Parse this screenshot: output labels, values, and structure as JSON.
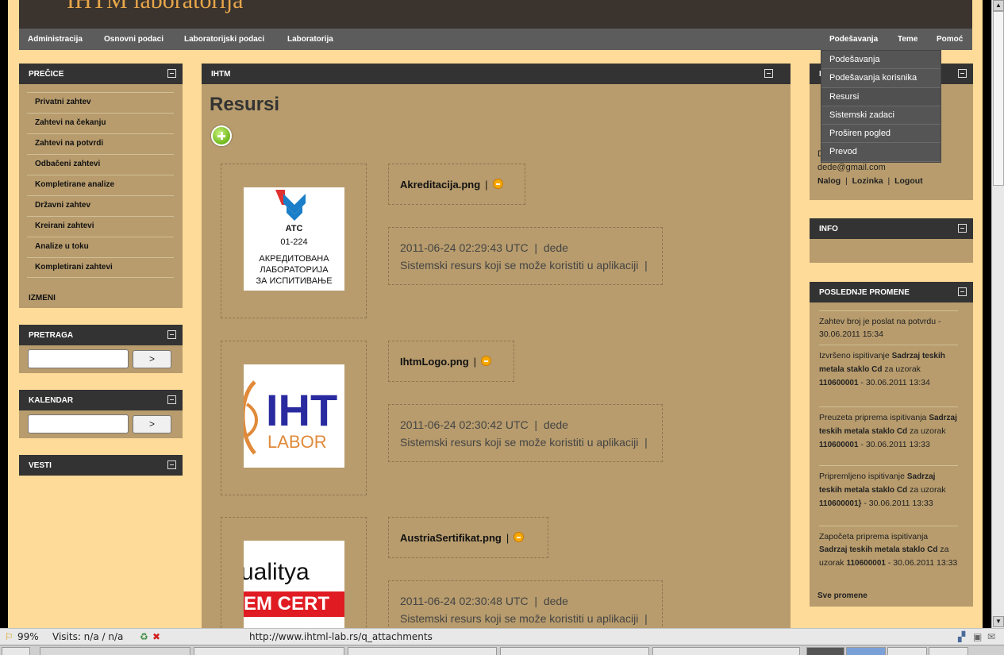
{
  "header": {
    "title": "IHTM laboratorija"
  },
  "menu": {
    "left": [
      "Administracija",
      "Osnovni podaci",
      "Laboratorijski podaci",
      "Laboratorija"
    ],
    "right": [
      "Podešavanja",
      "Teme",
      "Pomoć"
    ]
  },
  "dropdown": [
    "Podešavanja",
    "Podešavanja korisnika",
    "Resursi",
    "Sistemski zadaci",
    "Proširen pogled",
    "Prevod"
  ],
  "precice": {
    "title": "PREČICE",
    "items": [
      "Privatni zahtev",
      "Zahtevi na čekanju",
      "Zahtevi na potvrdi",
      "Odbačeni zahtevi",
      "Kompletirane analize",
      "Državni zahtev",
      "Kreirani zahtevi",
      "Analize u toku",
      "Kompletirani zahtevi"
    ],
    "edit": "IZMENI"
  },
  "pretraga": {
    "title": "PRETRAGA",
    "button": ">"
  },
  "kalendar": {
    "title": "KALENDAR",
    "button": ">"
  },
  "vesti": {
    "title": "VESTI"
  },
  "center": {
    "panel_title": "IHTM",
    "heading": "Resursi",
    "resources": [
      {
        "filename": "Akreditacija.png",
        "date": "2011-06-24 02:29:43 UTC",
        "user": "dede",
        "description": "Sistemski resurs koji se može koristiti u aplikaciji",
        "thumb_lines": [
          "ATC",
          "01-224",
          "АКРЕДИТОВАНА",
          "ЛАБОРАТОРИЈА",
          "ЗА ИСПИТИВАЊЕ"
        ]
      },
      {
        "filename": "IhtmLogo.png",
        "date": "2011-06-24 02:30:42 UTC",
        "user": "dede",
        "description": "Sistemski resurs koji se može koristiti u aplikaciji",
        "thumb_lines": [
          "IHT",
          "LABOR"
        ]
      },
      {
        "filename": "AustriaSertifikat.png",
        "date": "2011-06-24 02:30:48 UTC",
        "user": "dede",
        "description": "Sistemski resurs koji se može koristiti u aplikaciji",
        "thumb_lines": [
          "ualitya",
          "EM CERT"
        ]
      }
    ]
  },
  "user_panel": {
    "title_initial": "I",
    "name_initial": "D",
    "email": "dede@gmail.com",
    "links": [
      "Nalog",
      "Lozinka",
      "Logout"
    ]
  },
  "info": {
    "title": "INFO"
  },
  "changes": {
    "title": "POSLEDNJE PROMENE",
    "items": [
      {
        "pre": "Zahtev broj je poslat na potvrdu",
        "bold1": "",
        "mid": "",
        "bold2": "",
        "post": " - 30.06.2011 15:34"
      },
      {
        "pre": "Izvršeno ispitivanje ",
        "bold1": "Sadrzaj teskih metala staklo Cd",
        "mid": " za uzorak ",
        "bold2": "110600001",
        "post": " - 30.06.2011 13:34"
      },
      {
        "pre": "Preuzeta priprema ispitivanja ",
        "bold1": "Sadrzaj teskih metala staklo Cd",
        "mid": " za uzorak ",
        "bold2": "110600001",
        "post": " - 30.06.2011 13:33"
      },
      {
        "pre": "Pripremljeno ispitivanje ",
        "bold1": "Sadrzaj teskih metala staklo Cd",
        "mid": " za uzorak ",
        "bold2": "110600001}",
        "post": " - 30.06.2011 13:33"
      },
      {
        "pre": "Započeta priprema ispitivanja ",
        "bold1": "Sadrzaj teskih metala staklo Cd",
        "mid": " za uzorak ",
        "bold2": "110600001",
        "post": " - 30.06.2011 13:33"
      }
    ],
    "all": "Sve promene"
  },
  "status": {
    "zoom": "99%",
    "visits": "Visits: n/a / n/a",
    "url": "http://www.ihtml-lab.rs/q_attachments"
  }
}
